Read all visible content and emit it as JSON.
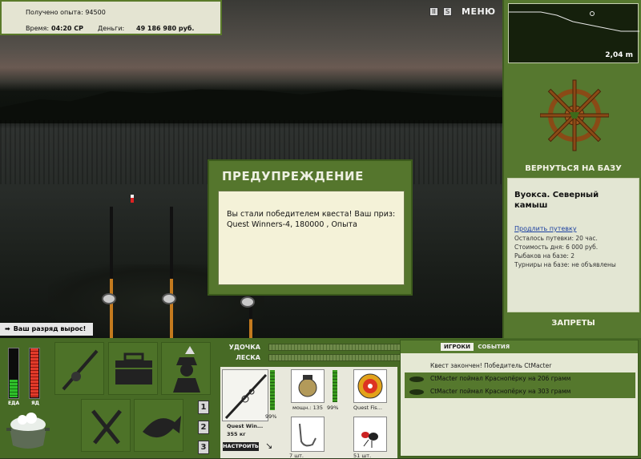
{
  "hud": {
    "experience_label": "Получено опыта:",
    "experience_value": "94500",
    "time_label": "Время:",
    "time_value": "04:20 СР",
    "money_label": "Деньги:",
    "money_value": "49 186 980 руб.",
    "pause_symbol": "II",
    "sound_symbol": "S",
    "menu_label": "МЕНЮ"
  },
  "notice": {
    "rank_up": "Ваш разряд вырос!"
  },
  "depth_panel": {
    "depth": "2,04 m"
  },
  "right_panel": {
    "return_base": "ВЕРНУТЬСЯ НА БАЗУ",
    "location_name": "Вуокса. Северный камыш",
    "extend_voucher": "Продлить путевку",
    "voucher_left": "Осталось путевки: 20 час.",
    "day_cost": "Стоимость дня: 6 000 руб.",
    "fishers_at_base": "Рыбаков на базе: 2",
    "tournaments": "Турниры на базе: не объявлены",
    "bans": "ЗАПРЕТЫ"
  },
  "dialog": {
    "title": "ПРЕДУПРЕЖДЕНИЕ",
    "message": "Вы стали победителем квеста! Ваш приз: Quest Winners-4, 180000 , Опыта"
  },
  "gauges": {
    "food_label": "ЕДА",
    "food_level": 0.35,
    "poison_label": "ЯД",
    "poison_level": 1.0
  },
  "slots_numbers": [
    "1",
    "2",
    "3"
  ],
  "tackle": {
    "rod_label": "УДОЧКА",
    "line_label": "ЛЕСКА",
    "rod_name": "Quest Win...",
    "rod_weight": "355 кг",
    "rod_percent": "99%",
    "reel_power": "мощн.: 135",
    "reel_percent": "99%",
    "line_name": "Quest Fis...",
    "hook_count": "7 шт.",
    "bait_count": "51 шт.",
    "setup_button": "НАСТРОИТЬ"
  },
  "chat": {
    "tab_players": "ИГРОКИ",
    "tab_events": "СОБЫТИЯ",
    "messages": [
      "Квест закончен! Победитель CtMacter",
      "CtMacter поймал Краснопёрку на 206 грамм",
      "CtMacter поймал Краснопёрку на 303 грамм"
    ]
  },
  "icons": [
    "rod-icon",
    "tackle-box-icon",
    "fisherman-icon",
    "knife-fork-icon",
    "fish-icon",
    "pot-icon",
    "ship-wheel-icon"
  ]
}
